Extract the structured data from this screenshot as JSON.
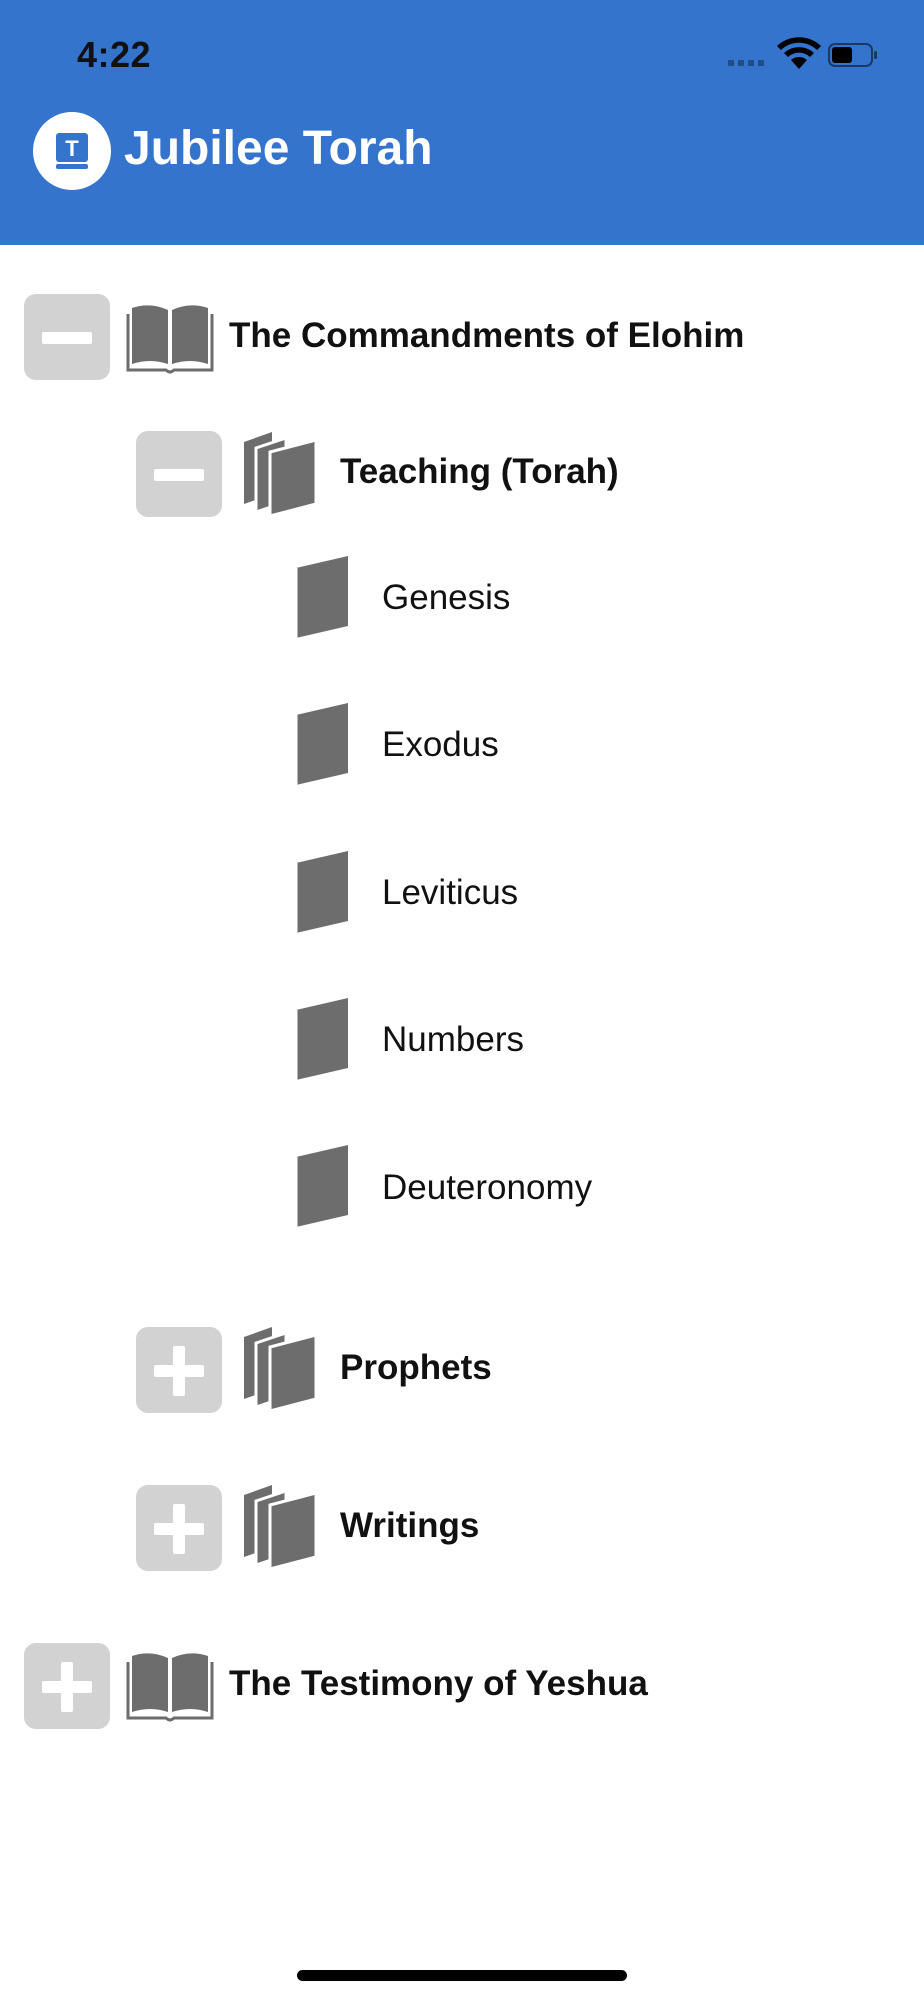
{
  "status_bar": {
    "time": "4:22",
    "icons": [
      "cellular-signal-icon",
      "wifi-icon",
      "battery-icon"
    ]
  },
  "header": {
    "title": "Jubilee Torah",
    "logo_letter": "T",
    "color": "#3474cd"
  },
  "tree": {
    "root1": {
      "label": "The Commandments of Elohim",
      "state": "expanded",
      "icon": "open-book-icon"
    },
    "torah": {
      "label": "Teaching (Torah)",
      "state": "expanded",
      "icon": "books-icon"
    },
    "books": [
      {
        "label": "Genesis",
        "icon": "book-icon"
      },
      {
        "label": "Exodus",
        "icon": "book-icon"
      },
      {
        "label": "Leviticus",
        "icon": "book-icon"
      },
      {
        "label": "Numbers",
        "icon": "book-icon"
      },
      {
        "label": "Deuteronomy",
        "icon": "book-icon"
      }
    ],
    "prophets": {
      "label": "Prophets",
      "state": "collapsed",
      "icon": "books-icon"
    },
    "writings": {
      "label": "Writings",
      "state": "collapsed",
      "icon": "books-icon"
    },
    "root2": {
      "label": "The Testimony of Yeshua",
      "state": "collapsed",
      "icon": "open-book-icon"
    }
  },
  "colors": {
    "toggle_background": "#d2d2d2",
    "icon_gray": "#6d6d6d"
  }
}
